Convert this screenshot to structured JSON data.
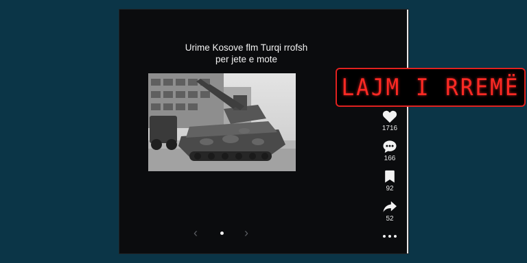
{
  "post": {
    "caption_line1": "Urime Kosove flm Turqi rrofsh",
    "caption_line2": "per jete e mote",
    "image_icon": "armored-vehicle-photo",
    "carousel": {
      "prev_icon": "chevron-left-icon",
      "next_icon": "chevron-right-icon",
      "dots": 1,
      "active_dot": 1
    }
  },
  "actions": {
    "like": {
      "icon": "heart-icon",
      "count": "1716"
    },
    "comment": {
      "icon": "comment-icon",
      "count": "166"
    },
    "save": {
      "icon": "bookmark-icon",
      "count": "92"
    },
    "share": {
      "icon": "share-icon",
      "count": "52"
    },
    "more": {
      "icon": "more-icon"
    }
  },
  "badge": {
    "text": "LAJM I RREMË",
    "color": "#ff2a24"
  },
  "colors": {
    "background": "#0b3547",
    "post_bg": "#0b0c0e",
    "badge_border": "#e2211f"
  }
}
